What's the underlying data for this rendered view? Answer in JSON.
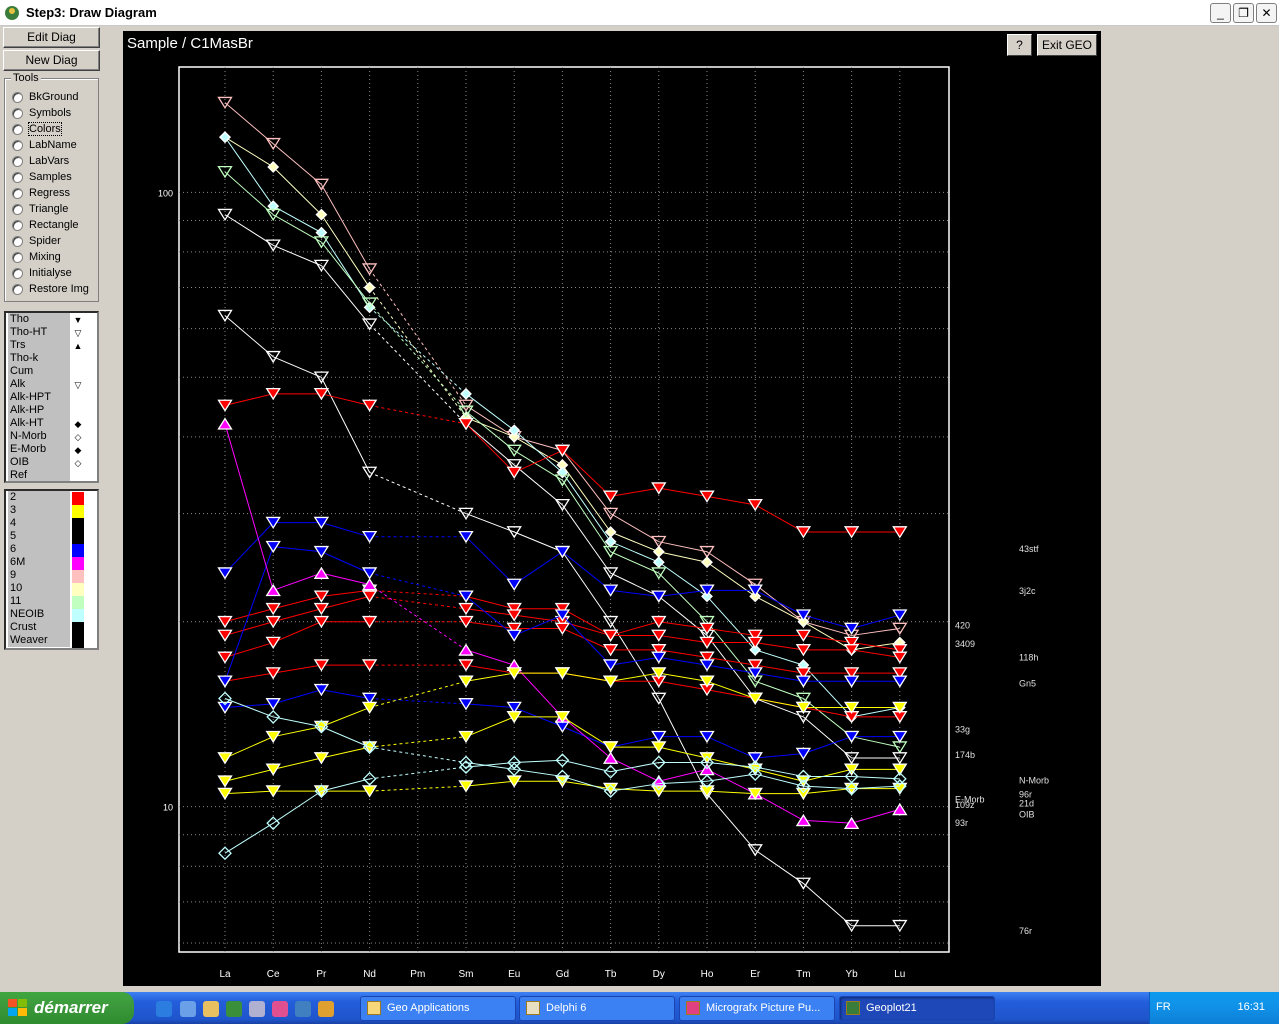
{
  "window": {
    "title": "Step3: Draw Diagram",
    "min_glyph": "_",
    "max_glyph": "❐",
    "close_glyph": "✕"
  },
  "toolbar": {
    "edit_diag": "Edit Diag",
    "new_diag": "New Diag"
  },
  "tools": {
    "title": "Tools",
    "items": [
      "BkGround",
      "Symbols",
      "Colors",
      "LabName",
      "LabVars",
      "Samples",
      "Regress",
      "Triangle",
      "Rectangle",
      "Spider",
      "Mixing",
      "Initialyse",
      "Restore Img"
    ]
  },
  "symbol_list": [
    {
      "label": "Tho",
      "sym": "▼"
    },
    {
      "label": "Tho-HT",
      "sym": "▽"
    },
    {
      "label": "Trs",
      "sym": "▲"
    },
    {
      "label": "Tho-k",
      "sym": ""
    },
    {
      "label": "Cum",
      "sym": ""
    },
    {
      "label": "Alk",
      "sym": "▽"
    },
    {
      "label": "Alk-HPT",
      "sym": ""
    },
    {
      "label": "Alk-HP",
      "sym": ""
    },
    {
      "label": "Alk-HT",
      "sym": "◆"
    },
    {
      "label": "N-Morb",
      "sym": "◇"
    },
    {
      "label": "E-Morb",
      "sym": "◆"
    },
    {
      "label": "OIB",
      "sym": "◇"
    },
    {
      "label": "Ref",
      "sym": ""
    }
  ],
  "color_list": [
    {
      "label": "2",
      "color": "#ff0000"
    },
    {
      "label": "3",
      "color": "#ffff00"
    },
    {
      "label": "4",
      "color": "#000000"
    },
    {
      "label": "5",
      "color": "#000000"
    },
    {
      "label": "6",
      "color": "#0000ff"
    },
    {
      "label": "6M",
      "color": "#ff00ff"
    },
    {
      "label": "9",
      "color": "#ffc0c0"
    },
    {
      "label": "10",
      "color": "#ffffc0"
    },
    {
      "label": "11",
      "color": "#c0ffc0"
    },
    {
      "label": "NEOIB",
      "color": "#c0ffff"
    },
    {
      "label": "Crust",
      "color": "#000000"
    },
    {
      "label": "Weaver",
      "color": "#000000"
    }
  ],
  "plot": {
    "title": "Sample / C1MasBr",
    "help_label": "?",
    "exit_label": "Exit GEO"
  },
  "chart_data": {
    "type": "line",
    "title": "Sample / C1MasBr",
    "x_categories": [
      "La",
      "Ce",
      "Pr",
      "Nd",
      "Pm",
      "Sm",
      "Eu",
      "Gd",
      "Tb",
      "Dy",
      "Ho",
      "Er",
      "Tm",
      "Yb",
      "Lu"
    ],
    "y_scale": "log",
    "y_ticks": [
      10,
      100
    ],
    "ylim": [
      5.8,
      160
    ],
    "grid": true,
    "right_labels": [
      {
        "text": "43stf",
        "y": 26.0
      },
      {
        "text": "3j2c",
        "y": 22.2
      },
      {
        "text": "420",
        "y": 19.5
      },
      {
        "text": "3409",
        "y": 18.2
      },
      {
        "text": "118h",
        "y": 17.3
      },
      {
        "text": "Gn5",
        "y": 15.7
      },
      {
        "text": "33g",
        "y": 13.2
      },
      {
        "text": "174b",
        "y": 12.0
      },
      {
        "text": "N-Morb",
        "y": 10.9
      },
      {
        "text": "96r",
        "y": 10.35
      },
      {
        "text": "E-Morb",
        "y": 10.15
      },
      {
        "text": "21d",
        "y": 10.0
      },
      {
        "text": "109z",
        "y": 9.95
      },
      {
        "text": "OIB",
        "y": 9.6
      },
      {
        "text": "93r",
        "y": 9.3
      },
      {
        "text": "76r",
        "y": 6.2
      }
    ],
    "series": [
      {
        "color": "#ffc0c0",
        "marker": "tri-down-open",
        "values": [
          140,
          120,
          103,
          75,
          null,
          45,
          40,
          38,
          30,
          27,
          26,
          23,
          20,
          19,
          19.5
        ]
      },
      {
        "color": "#ffffc0",
        "marker": "diamond",
        "values": [
          123,
          110,
          92,
          70,
          null,
          43,
          40,
          36,
          28,
          26,
          25,
          22,
          20,
          18,
          18.5
        ]
      },
      {
        "color": "#c0ffff",
        "marker": "diamond",
        "values": [
          123,
          95,
          86,
          65,
          null,
          47,
          41,
          35,
          27,
          25,
          22,
          18,
          17,
          14,
          14.5
        ]
      },
      {
        "color": "#c0ffc0",
        "marker": "tri-down-open",
        "values": [
          108,
          92,
          83,
          66,
          null,
          44,
          38,
          34,
          26,
          24,
          20,
          16,
          15,
          13,
          12.5
        ]
      },
      {
        "color": "#ffffff",
        "marker": "tri-down-open",
        "values": [
          92,
          82,
          76,
          61,
          null,
          42,
          36,
          31,
          24,
          22,
          19,
          15,
          14,
          12,
          12
        ]
      },
      {
        "color": "#ffffff",
        "marker": "tri-down-open",
        "values": [
          63,
          54,
          50,
          35,
          null,
          30,
          28,
          26,
          20,
          15,
          10.5,
          8.5,
          7.5,
          6.4,
          6.4
        ]
      },
      {
        "color": "#ff0000",
        "marker": "tri-down",
        "values": [
          45,
          47,
          47,
          45,
          null,
          42,
          35,
          38,
          32,
          33,
          32,
          31,
          28,
          28,
          28
        ]
      },
      {
        "color": "#ff0000",
        "marker": "tri-down",
        "values": [
          20,
          21,
          22,
          22.5,
          null,
          22,
          21,
          21,
          19,
          20,
          19.5,
          19,
          19,
          18.5,
          18
        ]
      },
      {
        "color": "#ff0000",
        "marker": "tri-down",
        "values": [
          19,
          20,
          21,
          22,
          null,
          21,
          20.5,
          20,
          19,
          19,
          18.5,
          18.5,
          18,
          18,
          17.5
        ]
      },
      {
        "color": "#ff0000",
        "marker": "tri-down",
        "values": [
          17.5,
          18.5,
          20,
          20,
          null,
          20,
          19.5,
          19.5,
          18,
          18,
          17.5,
          17,
          16.5,
          16.5,
          16.5
        ]
      },
      {
        "color": "#ff0000",
        "marker": "tri-down",
        "values": [
          16,
          16.5,
          17,
          17,
          null,
          17,
          16.5,
          16.5,
          16,
          16,
          15.5,
          15,
          14.5,
          14,
          14
        ]
      },
      {
        "color": "#0000ff",
        "marker": "tri-down",
        "values": [
          24,
          29,
          29,
          27.5,
          null,
          27.5,
          23,
          26,
          22.5,
          22,
          22.5,
          22.5,
          20.5,
          19.5,
          20.5
        ]
      },
      {
        "color": "#0000ff",
        "marker": "tri-down",
        "values": [
          16,
          26.5,
          26,
          24,
          null,
          22,
          19,
          20.5,
          17,
          17.5,
          17,
          16.5,
          16,
          16,
          16
        ]
      },
      {
        "color": "#0000ff",
        "marker": "tri-down",
        "values": [
          14.5,
          14.7,
          15.5,
          15,
          null,
          14.7,
          14.5,
          13.5,
          12.5,
          13,
          13,
          12,
          12.2,
          13,
          13
        ]
      },
      {
        "color": "#ff00ff",
        "marker": "tri-up",
        "values": [
          42,
          22.5,
          24,
          23,
          null,
          18,
          17,
          14,
          12,
          11,
          11.5,
          10.5,
          9.5,
          9.4,
          9.9
        ]
      },
      {
        "color": "#ffff00",
        "marker": "tri-down",
        "values": [
          12,
          13,
          13.5,
          14.5,
          null,
          16,
          16.5,
          16.5,
          16,
          16.5,
          16,
          15,
          14.5,
          14.5,
          14.5
        ]
      },
      {
        "color": "#ffff00",
        "marker": "tri-down",
        "values": [
          11,
          11.5,
          12,
          12.5,
          null,
          13,
          14,
          14,
          12.5,
          12.5,
          12,
          11.5,
          11,
          11.5,
          11.5
        ]
      },
      {
        "color": "#ffff00",
        "marker": "tri-down",
        "values": [
          10.5,
          10.6,
          10.6,
          10.6,
          null,
          10.8,
          11,
          11,
          10.7,
          10.6,
          10.6,
          10.5,
          10.5,
          10.7,
          10.7
        ]
      },
      {
        "color": "#c0ffff",
        "marker": "diamond-open",
        "values": [
          15,
          14,
          13.5,
          12.5,
          null,
          11.8,
          11.5,
          11.2,
          10.6,
          10.9,
          11,
          11.3,
          10.8,
          10.7,
          10.8
        ]
      },
      {
        "color": "#c0ffff",
        "marker": "diamond-open",
        "values": [
          8.4,
          9.4,
          10.6,
          11.1,
          null,
          11.6,
          11.8,
          11.9,
          11.4,
          11.8,
          11.8,
          11.6,
          11.2,
          11.2,
          11.1
        ]
      }
    ]
  },
  "taskbar": {
    "start_label": "démarrer",
    "tasks": [
      "Geo Applications",
      "Delphi 6",
      "Micrografx Picture Pu...",
      "Geoplot21"
    ],
    "lang": "FR",
    "clock": "16:31"
  }
}
